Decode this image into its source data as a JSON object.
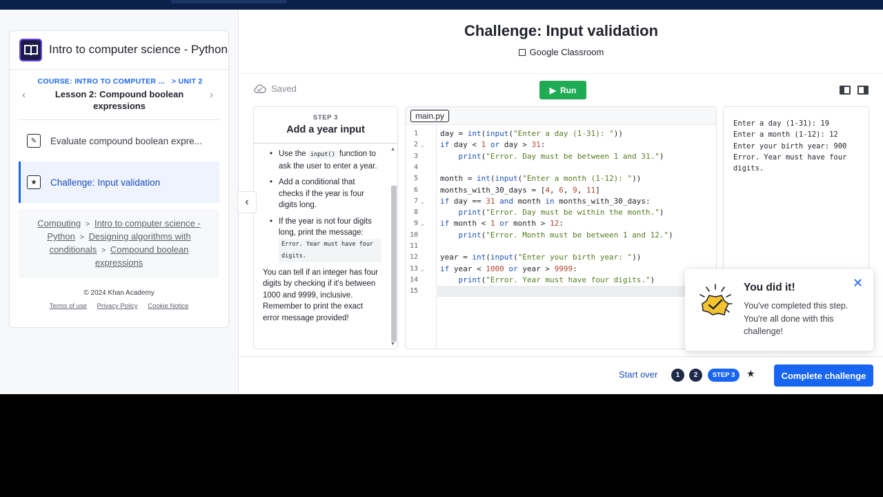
{
  "sidebar": {
    "course_title": "Intro to computer science - Python",
    "breadcrumb_course": "COURSE: INTRO TO COMPUTER ...",
    "breadcrumb_unit": "> UNIT 2",
    "lesson_title": "Lesson 2: Compound boolean expressions",
    "items": [
      {
        "label": "Evaluate compound boolean expre...",
        "icon": "pencil-icon"
      },
      {
        "label": "Challenge: Input validation",
        "icon": "star-icon"
      }
    ],
    "path": [
      "Computing",
      "Intro to computer science - Python",
      "Designing algorithms with conditionals",
      "Compound boolean expressions"
    ],
    "path_sep": ">",
    "copyright": "© 2024 Khan Academy",
    "footer_links": [
      "Terms of use",
      "Privacy Policy",
      "Cookie Notice"
    ]
  },
  "header": {
    "title": "Challenge: Input validation",
    "classroom": "Google Classroom"
  },
  "toolbar": {
    "saved": "Saved",
    "run": "Run"
  },
  "step": {
    "label": "STEP 3",
    "title": "Add a year input",
    "bullet1_pre": "Use the",
    "bullet1_code": "input()",
    "bullet1_post": "function to ask the user to enter a year.",
    "bullet2": "Add a conditional that checks if the year is four digits long.",
    "bullet3": "If the year is not four digits long, print the message:",
    "bullet3_code": "Error. Year must have four digits.",
    "paragraph": "You can tell if an integer has four digits by checking if it's between 1000 and 9999, inclusive. Remember to print the exact error message provided!"
  },
  "editor": {
    "file_name": "main.py",
    "lines": [
      "day = int(input(\"Enter a day (1-31): \"))",
      "if day < 1 or day > 31:",
      "    print(\"Error. Day must be between 1 and 31.\")",
      "",
      "month = int(input(\"Enter a month (1-12): \"))",
      "months_with_30_days = [4, 6, 9, 11]",
      "if day == 31 and month in months_with_30_days:",
      "    print(\"Error. Day must be within the month.\")",
      "if month < 1 or month > 12:",
      "    print(\"Error. Month must be between 1 and 12.\")",
      "",
      "year = int(input(\"Enter your birth year: \"))",
      "if year < 1000 or year > 9999:",
      "    print(\"Error. Year must have four digits.\")",
      ""
    ],
    "line_numbers": [
      "1",
      "2",
      "3",
      "4",
      "5",
      "6",
      "7",
      "8",
      "9",
      "10",
      "11",
      "12",
      "13",
      "14",
      "15"
    ],
    "fold_lines": [
      2,
      7,
      9,
      13
    ],
    "active_line": 15
  },
  "output": {
    "lines": [
      "Enter a day (1-31): 19",
      "Enter a month (1-12): 12",
      "Enter your birth year: 900",
      "Error. Year must have four digits."
    ]
  },
  "toast": {
    "title": "You did it!",
    "body": "You've completed this step. You're all done with this challenge!"
  },
  "footer": {
    "start_over": "Start over",
    "steps": [
      "1",
      "2"
    ],
    "current_step": "STEP 3",
    "complete": "Complete challenge"
  },
  "colors": {
    "accent": "#1865f2",
    "run_green": "#1fab54",
    "topbar": "#0b2149"
  }
}
